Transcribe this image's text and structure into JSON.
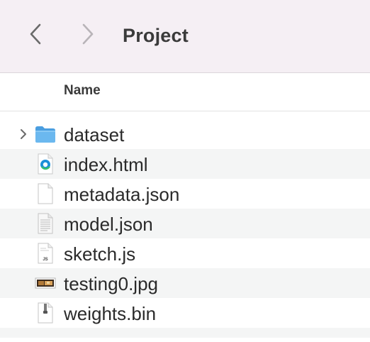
{
  "window": {
    "title": "Project"
  },
  "toolbar": {
    "back_icon": "chevron-left-icon",
    "forward_icon": "chevron-right-icon"
  },
  "table": {
    "column_name": "Name"
  },
  "files": [
    {
      "name": "dataset",
      "icon": "folder-icon",
      "expandable": true
    },
    {
      "name": "index.html",
      "icon": "edge-browser-icon",
      "expandable": false
    },
    {
      "name": "metadata.json",
      "icon": "blank-document-icon",
      "expandable": false
    },
    {
      "name": "model.json",
      "icon": "text-document-icon",
      "expandable": false
    },
    {
      "name": "sketch.js",
      "icon": "js-document-icon",
      "expandable": false
    },
    {
      "name": "testing0.jpg",
      "icon": "image-thumbnail-icon",
      "expandable": false
    },
    {
      "name": "weights.bin",
      "icon": "binary-document-icon",
      "expandable": false
    }
  ],
  "colors": {
    "toolbar_bg": "#f5eff4",
    "folder_blue": "#5aaee8",
    "row_alt": "#f4f5f5"
  }
}
